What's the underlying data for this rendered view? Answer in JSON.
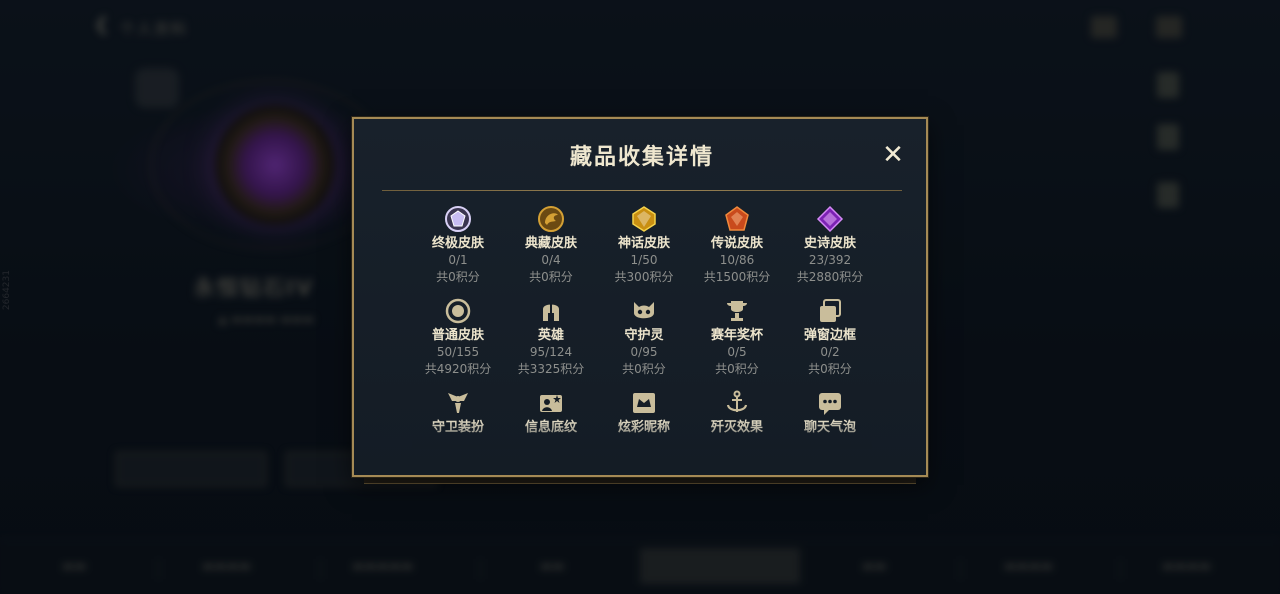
{
  "background": {
    "nav_back_label": "个人资料",
    "rank_title": "永恒钻石IV"
  },
  "modal": {
    "title": "藏品收集详情",
    "close_label": "✕",
    "items": [
      {
        "icon": "ultimate-skin-gem-icon",
        "name": "终极皮肤",
        "count": "0/1",
        "points": "共0积分",
        "color": "#b7a8e8"
      },
      {
        "icon": "prestige-skin-dragon-icon",
        "name": "典藏皮肤",
        "count": "0/4",
        "points": "共0积分",
        "color": "#d4a034"
      },
      {
        "icon": "mythic-skin-gem-icon",
        "name": "神话皮肤",
        "count": "1/50",
        "points": "共300积分",
        "color": "#e5b52a"
      },
      {
        "icon": "legendary-skin-gem-icon",
        "name": "传说皮肤",
        "count": "10/86",
        "points": "共1500积分",
        "color": "#e2632a"
      },
      {
        "icon": "epic-skin-gem-icon",
        "name": "史诗皮肤",
        "count": "23/392",
        "points": "共2880积分",
        "color": "#a43ad6"
      },
      {
        "icon": "common-skin-circle-icon",
        "name": "普通皮肤",
        "count": "50/155",
        "points": "共4920积分",
        "color": "#c9bd9b"
      },
      {
        "icon": "champion-helmet-icon",
        "name": "英雄",
        "count": "95/124",
        "points": "共3325积分",
        "color": "#c9bd9b"
      },
      {
        "icon": "little-legend-icon",
        "name": "守护灵",
        "count": "0/95",
        "points": "共0积分",
        "color": "#c9bd9b"
      },
      {
        "icon": "season-trophy-icon",
        "name": "赛年奖杯",
        "count": "0/5",
        "points": "共0积分",
        "color": "#c9bd9b"
      },
      {
        "icon": "popup-frame-icon",
        "name": "弹窗边框",
        "count": "0/2",
        "points": "共0积分",
        "color": "#c9bd9b"
      },
      {
        "icon": "guardian-costume-icon",
        "name": "守卫装扮",
        "count": "",
        "points": "",
        "color": "#c9bd9b"
      },
      {
        "icon": "info-card-pattern-icon",
        "name": "信息底纹",
        "count": "",
        "points": "",
        "color": "#c9bd9b"
      },
      {
        "icon": "colorful-nickname-icon",
        "name": "炫彩昵称",
        "count": "",
        "points": "",
        "color": "#c9bd9b"
      },
      {
        "icon": "annihilation-effect-icon",
        "name": "歼灭效果",
        "count": "",
        "points": "",
        "color": "#c9bd9b"
      },
      {
        "icon": "chat-bubble-icon",
        "name": "聊天气泡",
        "count": "",
        "points": "",
        "color": "#c9bd9b"
      }
    ]
  }
}
